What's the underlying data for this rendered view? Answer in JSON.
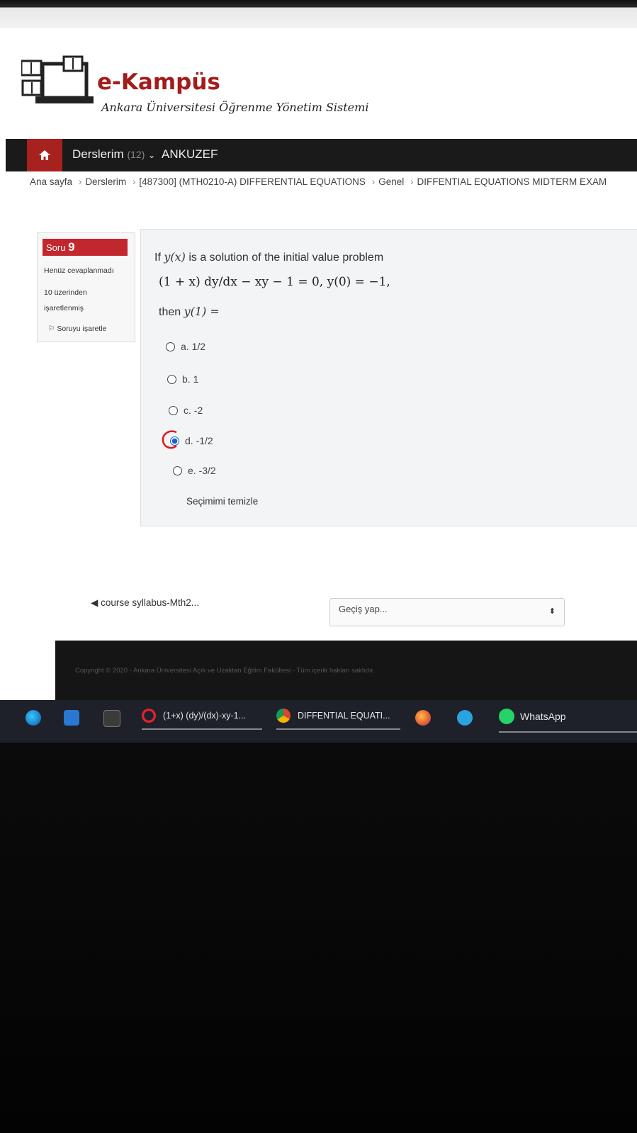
{
  "brand": {
    "title": "e-Kampüs",
    "subtitle": "Ankara Üniversitesi Öğrenme Yönetim Sistemi"
  },
  "navbar": {
    "home_icon": "home-icon",
    "courses_label": "Derslerim",
    "courses_count": "(12)",
    "chevron": "⌄",
    "ankuzef_label": "ANKUZEF"
  },
  "breadcrumb": [
    "Ana sayfa",
    "Derslerim",
    "[487300] (MTH0210-A) DIFFERENTIAL EQUATIONS",
    "Genel",
    "DIFFENTIAL EQUATIONS MIDTERM EXAM"
  ],
  "question_info": {
    "label": "Soru",
    "number": "9",
    "state": "Henüz cevaplanmadı",
    "mark_line1": "10 üzerinden",
    "mark_line2": "işaretlenmiş",
    "flag_label": "Soruyu işaretle"
  },
  "question": {
    "intro_prefix": "If ",
    "intro_var": "y(x)",
    "intro_suffix": " is a solution of the initial value problem",
    "equation": "(1 + x) dy/dx − xy − 1 = 0, y(0) = −1,",
    "then_prefix": "then ",
    "then_expr": "y(1) ="
  },
  "answers": [
    {
      "label": "a. 1/2",
      "selected": false
    },
    {
      "label": "b. 1",
      "selected": false
    },
    {
      "label": "c. -2",
      "selected": false
    },
    {
      "label": "d. -1/2",
      "selected": true
    },
    {
      "label": "e. -3/2",
      "selected": false
    }
  ],
  "clear_choice": "Seçimimi temizle",
  "navigation": {
    "prev_link": "course syllabus-Mth2...",
    "jump_placeholder": "Geçiş yap...",
    "jump_arrow": "⬍"
  },
  "footer": {
    "copyright": "Copyright © 2020 - Ankara Üniversitesi Açık ve Uzaktan Eğitim Fakültesi - Tüm içerik hakları saklıdır."
  },
  "taskbar": {
    "app1": "(1+x) (dy)/(dx)-xy-1...",
    "app2": "DIFFENTIAL EQUATI...",
    "whatsapp": "WhatsApp"
  },
  "colors": {
    "brand_red": "#a31c1c",
    "question_badge": "#c1272d",
    "navbar": "#1a1a1a",
    "radio_selected": "#1a5fd0",
    "annotation_red": "#e01818"
  }
}
